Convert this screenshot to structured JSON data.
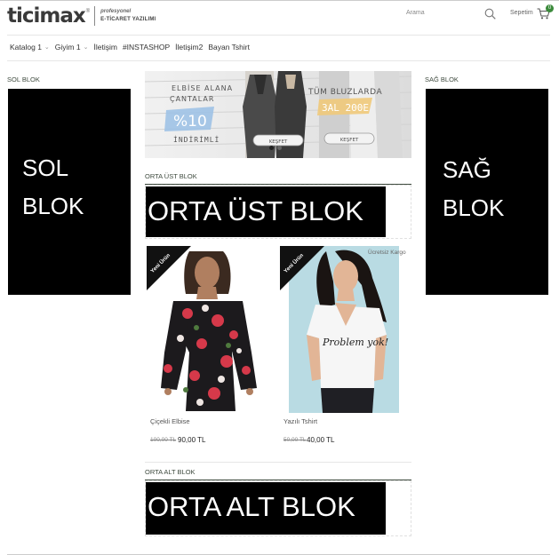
{
  "header": {
    "logo_main": "ticimax",
    "logo_reg": "®",
    "logo_sub1": "profesyonel",
    "logo_sub2": "E-TİCARET YAZILIMI",
    "search_label": "Arama",
    "cart_label": "Sepetim",
    "cart_count": "0"
  },
  "nav": {
    "items": [
      {
        "label": "Katalog 1"
      },
      {
        "label": "Giyim 1"
      },
      {
        "label": "İletişim"
      },
      {
        "label": "#INSTASHOP"
      },
      {
        "label": "İletişim2"
      },
      {
        "label": "Bayan Tshirt"
      }
    ]
  },
  "blocks": {
    "left_title": "SOL BLOK",
    "left_line1": "SOL",
    "left_line2": "BLOK",
    "right_title": "SAĞ BLOK",
    "right_line1": "SAĞ",
    "right_line2": "BLOK",
    "mid_top_title": "ORTA ÜST BLOK",
    "mid_top_text": "ORTA ÜST BLOK",
    "mid_bottom_title": "ORTA ALT BLOK",
    "mid_bottom_text": "ORTA ALT BLOK"
  },
  "slider": {
    "left_line1": "ELBİSE ALANA",
    "left_line2": "ÇANTALAR",
    "left_big": "%10",
    "left_line3": "İNDİRİMLİ",
    "left_button": "KEŞFET",
    "right_line1": "TÜM BLUZLARDA",
    "right_big": "3AL 200E",
    "right_button": "KEŞFET",
    "active_slide": 1,
    "slide_count": 2
  },
  "products": [
    {
      "name": "Çiçekli Elbise",
      "old_price": "100,00 TL",
      "price": "90,00 TL",
      "badge": "Yeni Ürün",
      "free_shipping": ""
    },
    {
      "name": "Yazılı Tshirt",
      "old_price": "50,00 TL",
      "price": "40,00 TL",
      "badge": "Yeni Ürün",
      "free_shipping": "Ücretsiz Kargo",
      "shirt_text": "Problem yok!"
    }
  ],
  "colors": {
    "accent": "#3b8a3b",
    "block_bg": "#000000",
    "block_text": "#ffffff"
  }
}
